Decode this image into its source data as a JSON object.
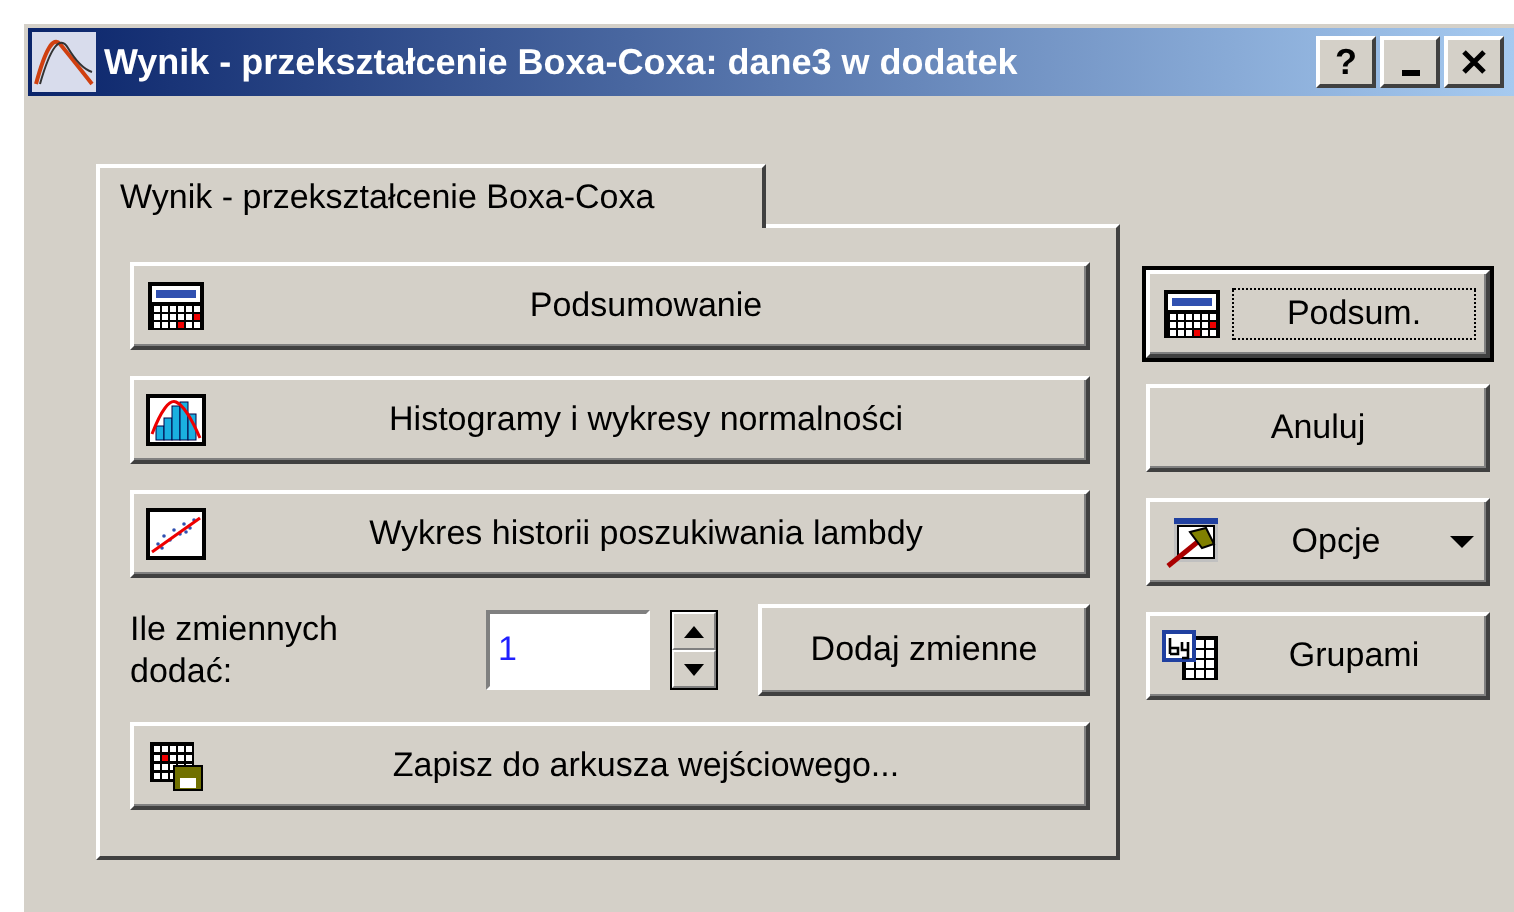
{
  "window": {
    "title": "Wynik - przekształcenie Boxa-Coxa: dane3 w dodatek",
    "help": "?"
  },
  "tabs": [
    {
      "label": "Wynik - przekształcenie Boxa-Coxa",
      "selected": true
    }
  ],
  "actions": [
    {
      "label": "Podsumowanie",
      "kind": "summary"
    },
    {
      "label": "Histogramy i wykresy normalności",
      "kind": "histogram"
    },
    {
      "label": "Wykres historii poszukiwania lambdy",
      "kind": "scatter"
    }
  ],
  "add_variables": {
    "label": "Ile zmiennych dodać:",
    "value": "1",
    "button": "Dodaj zmienne"
  },
  "save": {
    "label": "Zapisz do arkusza wejściowego...",
    "kind": "save"
  },
  "side_buttons": [
    {
      "label": "Podsum.",
      "kind": "summary",
      "default": true,
      "dropdown": false
    },
    {
      "label": "Anuluj",
      "kind": "plain",
      "default": false,
      "dropdown": false
    },
    {
      "label": "Opcje",
      "kind": "hammer",
      "default": false,
      "dropdown": true
    },
    {
      "label": "Grupami",
      "kind": "bygroup",
      "default": false,
      "dropdown": false
    }
  ]
}
